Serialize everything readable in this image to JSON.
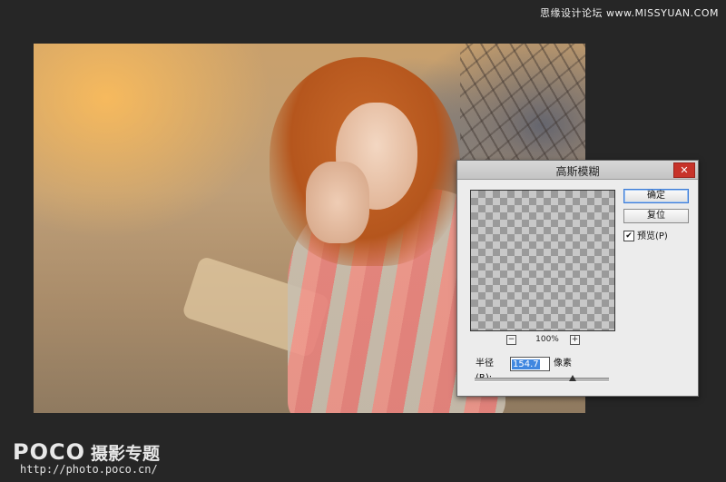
{
  "watermark_top": "思缘设计论坛 www.MISSYUAN.COM",
  "dialog": {
    "title": "高斯模糊",
    "close_icon": "close-icon",
    "zoom": {
      "minus": "−",
      "level": "100%",
      "plus": "+"
    },
    "buttons": {
      "ok": "确定",
      "reset": "复位"
    },
    "preview_checkbox": {
      "checked": true,
      "mark": "✔",
      "label": "预览(P)"
    },
    "radius": {
      "label": "半径(R):",
      "value": "154.7",
      "unit": "像素",
      "slider_fraction": 0.73
    }
  },
  "logo": {
    "brand": "POCO",
    "subtitle": "摄影专题",
    "url": "http://photo.poco.cn/"
  },
  "colors": {
    "accent": "#3f87e0",
    "close": "#c7332a",
    "background": "#262626"
  }
}
